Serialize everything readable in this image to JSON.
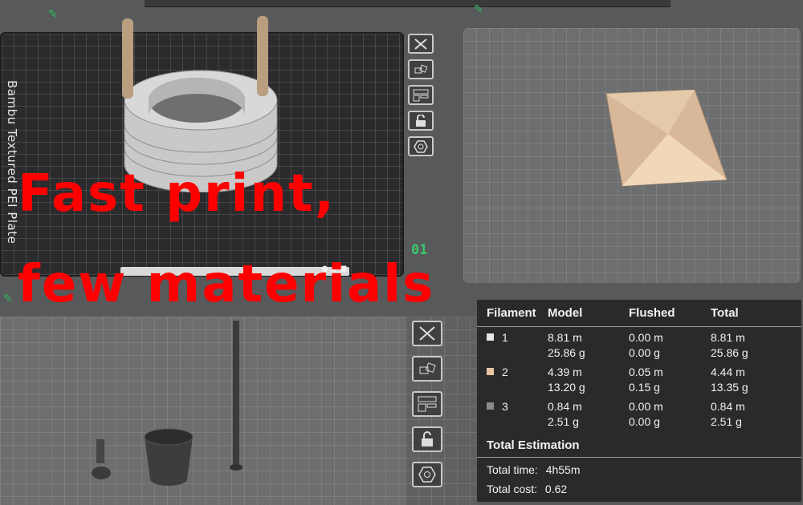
{
  "plate": {
    "label": "Bambu Textured PEI Plate",
    "number": "01"
  },
  "overlay": {
    "line1": "Fast print,",
    "line2": "few materials"
  },
  "icons": {
    "toolbar_top": [
      "close-icon",
      "auto-arrange-icon",
      "layout-icon",
      "lock-icon",
      "settings-icon"
    ],
    "toolbar_bottom": [
      "close-icon",
      "auto-arrange-icon",
      "layout-icon",
      "lock-icon",
      "settings-icon"
    ],
    "edit": "pencil-icon"
  },
  "stats": {
    "headers": [
      "Filament",
      "Model",
      "Flushed",
      "Total"
    ],
    "filaments": [
      {
        "id": "1",
        "color": "#e6e6e6",
        "model": [
          "8.81 m",
          "25.86 g"
        ],
        "flushed": [
          "0.00 m",
          "0.00 g"
        ],
        "total": [
          "8.81 m",
          "25.86 g"
        ]
      },
      {
        "id": "2",
        "color": "#e8c6a4",
        "model": [
          "4.39 m",
          "13.20 g"
        ],
        "flushed": [
          "0.05 m",
          "0.15 g"
        ],
        "total": [
          "4.44 m",
          "13.35 g"
        ]
      },
      {
        "id": "3",
        "color": "#8a8a8a",
        "model": [
          "0.84 m",
          "2.51 g"
        ],
        "flushed": [
          "0.00 m",
          "0.00 g"
        ],
        "total": [
          "0.84 m",
          "2.51 g"
        ]
      }
    ],
    "estimation_title": "Total Estimation",
    "time_label": "Total time:",
    "time_value": "4h55m",
    "cost_label": "Total cost:",
    "cost_value": "0.62"
  },
  "colors": {
    "accent_green": "#39c86a",
    "overlay_red": "#ff0000",
    "model_grey": "#cfcfcf",
    "model_tan": "#e2c4a2"
  }
}
